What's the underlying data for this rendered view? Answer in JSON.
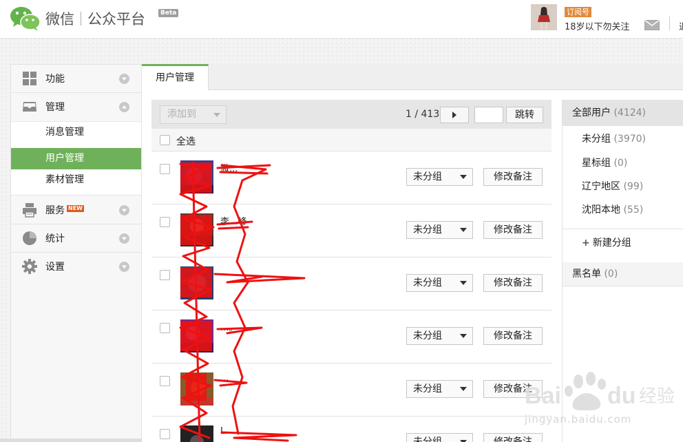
{
  "header": {
    "brand_left": "微信",
    "brand_right": "公众平台",
    "beta": "Beta",
    "account_type": "订阅号",
    "account_name": "18岁以下勿关注",
    "trailing_char": "退"
  },
  "sidebar": {
    "items": [
      {
        "label": "功能",
        "icon": "grid-icon"
      },
      {
        "label": "管理",
        "icon": "inbox-icon"
      },
      {
        "label": "服务",
        "icon": "printer-icon",
        "badge": "NEW"
      },
      {
        "label": "统计",
        "icon": "pie-chart-icon"
      },
      {
        "label": "设置",
        "icon": "gear-icon"
      }
    ],
    "sub_items": [
      {
        "label": "消息管理"
      },
      {
        "label": "用户管理",
        "active": true
      },
      {
        "label": "素材管理"
      }
    ]
  },
  "tab": {
    "label": "用户管理"
  },
  "toolbar": {
    "add_to_label": "添加到",
    "page_indicator": "1 / 413",
    "page_input": "",
    "jump_label": "跳转"
  },
  "select_all_label": "全选",
  "users": [
    {
      "name": "微...",
      "group": "未分组",
      "remark_label": "修改备注"
    },
    {
      "name": "李...峰",
      "group": "未分组",
      "remark_label": "修改备注"
    },
    {
      "name": "...",
      "group": "未分组",
      "remark_label": "修改备注"
    },
    {
      "name": "...。",
      "group": "未分组",
      "remark_label": "修改备注"
    },
    {
      "name": "...",
      "group": "未分组",
      "remark_label": "修改备注"
    },
    {
      "name": "L...",
      "group": "未分组",
      "remark_label": "修改备注"
    }
  ],
  "groups_panel": {
    "all_users": {
      "label": "全部用户",
      "count": "(4124)"
    },
    "groups": [
      {
        "label": "未分组",
        "count": "(3970)"
      },
      {
        "label": "星标组",
        "count": "(0)"
      },
      {
        "label": "辽宁地区",
        "count": "(99)"
      },
      {
        "label": "沈阳本地",
        "count": "(55)"
      }
    ],
    "new_group_label": "新建分组",
    "blacklist": {
      "label": "黑名单",
      "count": "(0)"
    }
  },
  "watermark": {
    "brand": "Baidu经验",
    "url": "jingyan.baidu.com"
  },
  "colors": {
    "accent_green": "#6fb15a",
    "account_tag": "#e08a3c",
    "scribble": "#ee1111"
  }
}
